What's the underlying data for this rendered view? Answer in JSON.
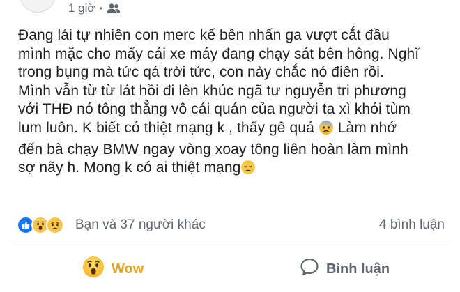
{
  "post": {
    "time": "1 giờ",
    "separator": "•",
    "privacy_icon": "friends-icon",
    "lines": [
      "Đang lái tự nhiên con merc kế bên nhấn ga vượt cắt đầu",
      "mình mặc cho mấy cái xe máy đang chạy sát bên hông. Nghĩ",
      "trong bụng mà tức qá trời tức, con này chắc nó điên rồi.",
      "Mình vẫn từ từ lát hồi đi lên khúc ngã tư nguyễn tri phương",
      "với THĐ nó tông thẳng vô cái quán của người ta xì khói tùm"
    ],
    "line6_before_emoji": "lum luôn. K biết có thiệt mạng k , thấy gê quá ",
    "line6_after_emoji": " Làm nhớ",
    "line7": "đến bà chạy BMW ngay vòng xoay tông liên hoàn làm mình",
    "line8": "sợ nãy h. Mong k có ai thiệt mạng",
    "emoji_1": "anxious-face-icon",
    "emoji_2": "sad-relieved-face-icon"
  },
  "reactions": {
    "icons": [
      "like-reaction-icon",
      "wow-reaction-icon",
      "sad-reaction-icon"
    ],
    "label": "Bạn và 37 người khác",
    "comments": "4 bình luận"
  },
  "actions": {
    "wow_label": "Wow",
    "comment_label": "Bình luận"
  },
  "colors": {
    "wow": "#e7a41d",
    "like": "#1877f2",
    "muted": "#606770"
  }
}
